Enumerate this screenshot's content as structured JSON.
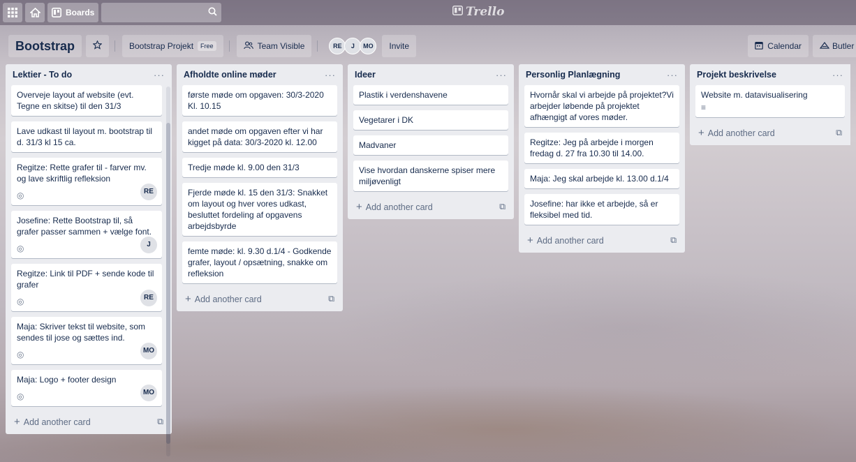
{
  "header": {
    "boards_label": "Boards",
    "logo_text": "Trello"
  },
  "board": {
    "title": "Bootstrap",
    "team_name": "Bootstrap Projekt",
    "plan_badge": "Free",
    "visibility": "Team Visible",
    "invite_label": "Invite",
    "members": [
      "RE",
      "J",
      "MO"
    ],
    "calendar_label": "Calendar",
    "butler_label": "Butler"
  },
  "add_card_label": "Add another card",
  "lists": [
    {
      "title": "Lektier - To do",
      "cards": [
        {
          "text": "Overveje layout af website (evt. Tegne en skitse) til den 31/3"
        },
        {
          "text": "Lave udkast til layout m. bootstrap til d. 31/3 kl 15 ca."
        },
        {
          "text": "Regitze: Rette grafer til - farver mv. og lave skriftlig refleksion",
          "member": "RE"
        },
        {
          "text": "Josefine: Rette Bootstrap til, så grafer passer sammen + vælge font.",
          "member": "J"
        },
        {
          "text": "Regitze: Link til PDF + sende kode til grafer",
          "member": "RE"
        },
        {
          "text": "Maja: Skriver tekst til website, som sendes til jose og sættes ind.",
          "member": "MO"
        },
        {
          "text": "Maja: Logo + footer design",
          "member": "MO"
        }
      ]
    },
    {
      "title": "Afholdte online møder",
      "cards": [
        {
          "text": "første møde om opgaven: 30/3-2020 Kl. 10.15"
        },
        {
          "text": "andet møde om opgaven efter vi har kigget på data: 30/3-2020 kl. 12.00"
        },
        {
          "text": "Tredje møde kl. 9.00 den 31/3"
        },
        {
          "text": "Fjerde møde kl. 15 den 31/3: Snakket om layout og hver vores udkast, besluttet fordeling af opgavens arbejdsbyrde"
        },
        {
          "text": "femte møde: kl. 9.30 d.1/4 - Godkende grafer, layout / opsætning, snakke om refleksion"
        }
      ]
    },
    {
      "title": "Ideer",
      "cards": [
        {
          "text": "Plastik i verdenshavene"
        },
        {
          "text": "Vegetarer i DK"
        },
        {
          "text": "Madvaner"
        },
        {
          "text": "Vise hvordan danskerne spiser mere miljøvenligt"
        }
      ]
    },
    {
      "title": "Personlig Planlægning",
      "cards": [
        {
          "text": "Hvornår skal vi arbejde på projektet?Vi arbejder løbende på projektet afhængigt af vores møder."
        },
        {
          "text": "Regitze: Jeg på arbejde i morgen fredag d. 27 fra 10.30 til 14.00."
        },
        {
          "text": "Maja: Jeg skal arbejde kl. 13.00 d.1/4"
        },
        {
          "text": "Josefine: har ikke et arbejde, så er fleksibel med tid."
        }
      ]
    },
    {
      "title": "Projekt beskrivelse",
      "cards": [
        {
          "text": "Website m. datavisualisering",
          "has_description": true
        }
      ]
    }
  ]
}
